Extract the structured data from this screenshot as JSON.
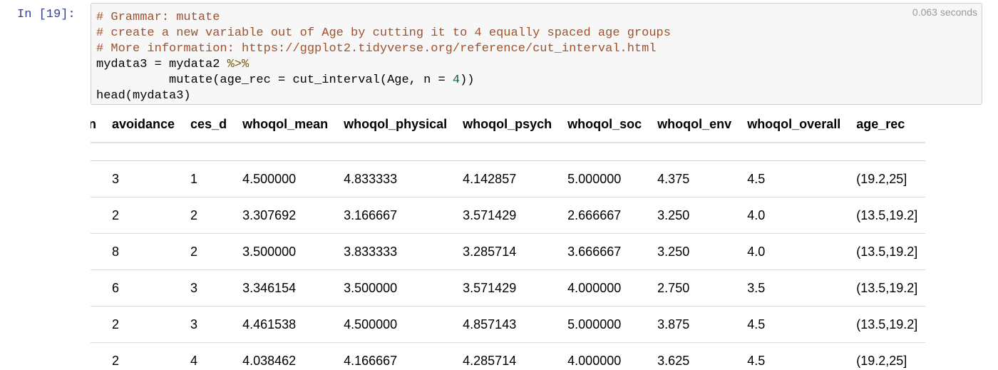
{
  "cell": {
    "prompt": "In [19]:",
    "exec_time": "0.063 seconds",
    "code": {
      "line1": "# Grammar: mutate",
      "line2": "# create a new variable out of Age by cutting it to 4 equally spaced age groups",
      "line3": "# More information: https://ggplot2.tidyverse.org/reference/cut_interval.html",
      "line4_a": "mydata3 = mydata2 ",
      "line4_op": "%>%",
      "line5_a": "          mutate(age_rec = cut_interval(Age, n = ",
      "line5_num": "4",
      "line5_b": "))",
      "line6": "head(mydata3)"
    }
  },
  "table": {
    "columns": [
      "tion",
      "avoidance",
      "ces_d",
      "whoqol_mean",
      "whoqol_physical",
      "whoqol_psych",
      "whoqol_soc",
      "whoqol_env",
      "whoqol_overall",
      "age_rec"
    ],
    "rows": [
      [
        "",
        "3",
        "1",
        "4.500000",
        "4.833333",
        "4.142857",
        "5.000000",
        "4.375",
        "4.5",
        "(19.2,25]"
      ],
      [
        "",
        "2",
        "2",
        "3.307692",
        "3.166667",
        "3.571429",
        "2.666667",
        "3.250",
        "4.0",
        "(13.5,19.2]"
      ],
      [
        "",
        "8",
        "2",
        "3.500000",
        "3.833333",
        "3.285714",
        "3.666667",
        "3.250",
        "4.0",
        "(13.5,19.2]"
      ],
      [
        "",
        "6",
        "3",
        "3.346154",
        "3.500000",
        "3.571429",
        "4.000000",
        "2.750",
        "3.5",
        "(13.5,19.2]"
      ],
      [
        "",
        "2",
        "3",
        "4.461538",
        "4.500000",
        "4.857143",
        "5.000000",
        "3.875",
        "4.5",
        "(13.5,19.2]"
      ],
      [
        "",
        "2",
        "4",
        "4.038462",
        "4.166667",
        "4.285714",
        "4.000000",
        "3.625",
        "4.5",
        "(19.2,25]"
      ]
    ]
  }
}
